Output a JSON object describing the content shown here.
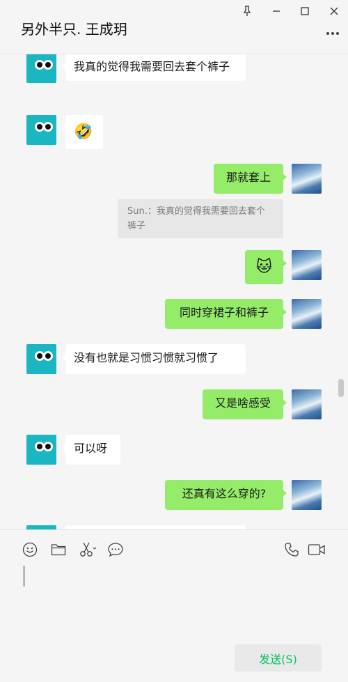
{
  "window": {
    "title": "另外半只. 王成玥",
    "controls": [
      "pin-icon",
      "minimize-icon",
      "maximize-icon",
      "close-icon"
    ],
    "more_icon": "more-icon"
  },
  "messages": [
    {
      "from": "peer",
      "text": "我真的觉得我需要回去套个裤子"
    },
    {
      "from": "peer",
      "emoji": "🤣"
    },
    {
      "from": "self",
      "text": "那就套上"
    },
    {
      "quote": "Sun.：我真的觉得我需要回去套个裤子"
    },
    {
      "from": "self",
      "emoji": "🐱"
    },
    {
      "from": "self",
      "text": "同时穿裙子和裤子"
    },
    {
      "from": "peer",
      "text": "没有也就是习惯习惯就习惯了"
    },
    {
      "from": "self",
      "text": "又是啥感受"
    },
    {
      "from": "peer",
      "text": "可以呀"
    },
    {
      "from": "self",
      "text": "还真有这么穿的?"
    }
  ],
  "toolbar": {
    "icons": [
      "emoji-icon",
      "folder-icon",
      "scissors-icon",
      "chat-history-icon",
      "phone-icon",
      "video-icon"
    ]
  },
  "composer": {
    "value": "",
    "send_label": "发送(S)"
  },
  "colors": {
    "background": "#f5f5f5",
    "bubble_in": "#ffffff",
    "bubble_out": "#95ec69",
    "quote_bg": "#e7e7e7",
    "send_text": "#07c160",
    "peer_avatar": "#1ab6c1"
  }
}
